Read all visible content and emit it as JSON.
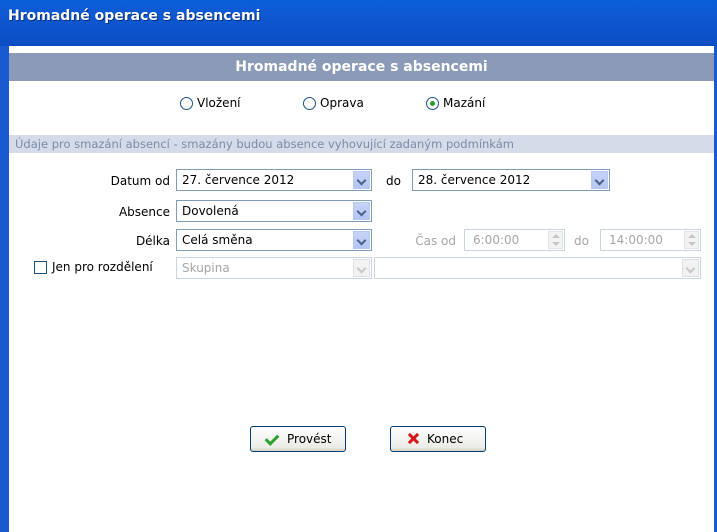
{
  "window": {
    "title": "Hromadné operace s absencemi"
  },
  "header": {
    "title": "Hromadné operace s absencemi"
  },
  "mode": {
    "options": [
      {
        "label": "Vložení",
        "selected": false
      },
      {
        "label": "Oprava",
        "selected": false
      },
      {
        "label": "Mazání",
        "selected": true
      }
    ]
  },
  "section": {
    "text": "Údaje pro smazání absencí - smazány budou absence vyhovující zadaným podmínkám"
  },
  "form": {
    "date_from_label": "Datum od",
    "date_from_value": "27. července 2012",
    "date_to_label": "do",
    "date_to_value": "28. července 2012",
    "absence_label": "Absence",
    "absence_value": "Dovolená",
    "length_label": "Délka",
    "length_value": "Celá směna",
    "time_from_label": "Čas od",
    "time_from_value": "6:00:00",
    "time_to_label": "do",
    "time_to_value": "14:00:00",
    "split_label": "Jen pro rozdělení",
    "split_checked": false,
    "group_value": "Skupina",
    "group_detail_value": ""
  },
  "buttons": {
    "execute_label": "Provést",
    "close_label": "Konec"
  },
  "colors": {
    "titlebar": "#0b57cf",
    "header_bg": "#8a9ab7",
    "section_bg": "#d5dbe8",
    "section_text": "#7b8ba8"
  }
}
